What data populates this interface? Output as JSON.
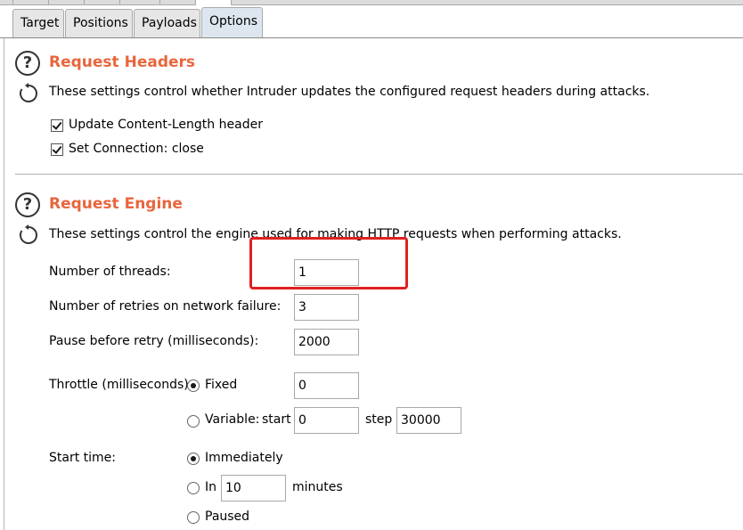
{
  "tabs": [
    {
      "label": "Target"
    },
    {
      "label": "Positions"
    },
    {
      "label": "Payloads"
    },
    {
      "label": "Options",
      "active": true
    }
  ],
  "request_headers": {
    "title": "Request Headers",
    "description": "These settings control whether Intruder updates the configured request headers during attacks.",
    "update_content_length": {
      "label": "Update Content-Length header",
      "checked": true
    },
    "set_connection_close": {
      "label": "Set Connection: close",
      "checked": true
    }
  },
  "request_engine": {
    "title": "Request Engine",
    "description": "These settings control the engine used for making HTTP requests when performing attacks.",
    "threads": {
      "label": "Number of threads:",
      "value": "1"
    },
    "retries": {
      "label": "Number of retries on network failure:",
      "value": "3"
    },
    "pause": {
      "label": "Pause before retry (milliseconds):",
      "value": "2000"
    },
    "throttle": {
      "label": "Throttle (milliseconds):",
      "fixed_label": "Fixed",
      "fixed_value": "0",
      "variable_label": "Variable:",
      "start_label": "start",
      "start_value": "0",
      "step_label": "step",
      "step_value": "30000",
      "selected": "fixed"
    },
    "start_time": {
      "label": "Start time:",
      "immediately_label": "Immediately",
      "in_label": "In",
      "in_value": "10",
      "minutes_label": "minutes",
      "paused_label": "Paused",
      "selected": "immediately"
    }
  },
  "colors": {
    "section_title": "#e8663d",
    "highlight_box": "#e02020",
    "active_tab": "#dde6ee"
  },
  "icons": {
    "help": "question-circle-icon",
    "refresh": "circular-arrow-icon"
  }
}
